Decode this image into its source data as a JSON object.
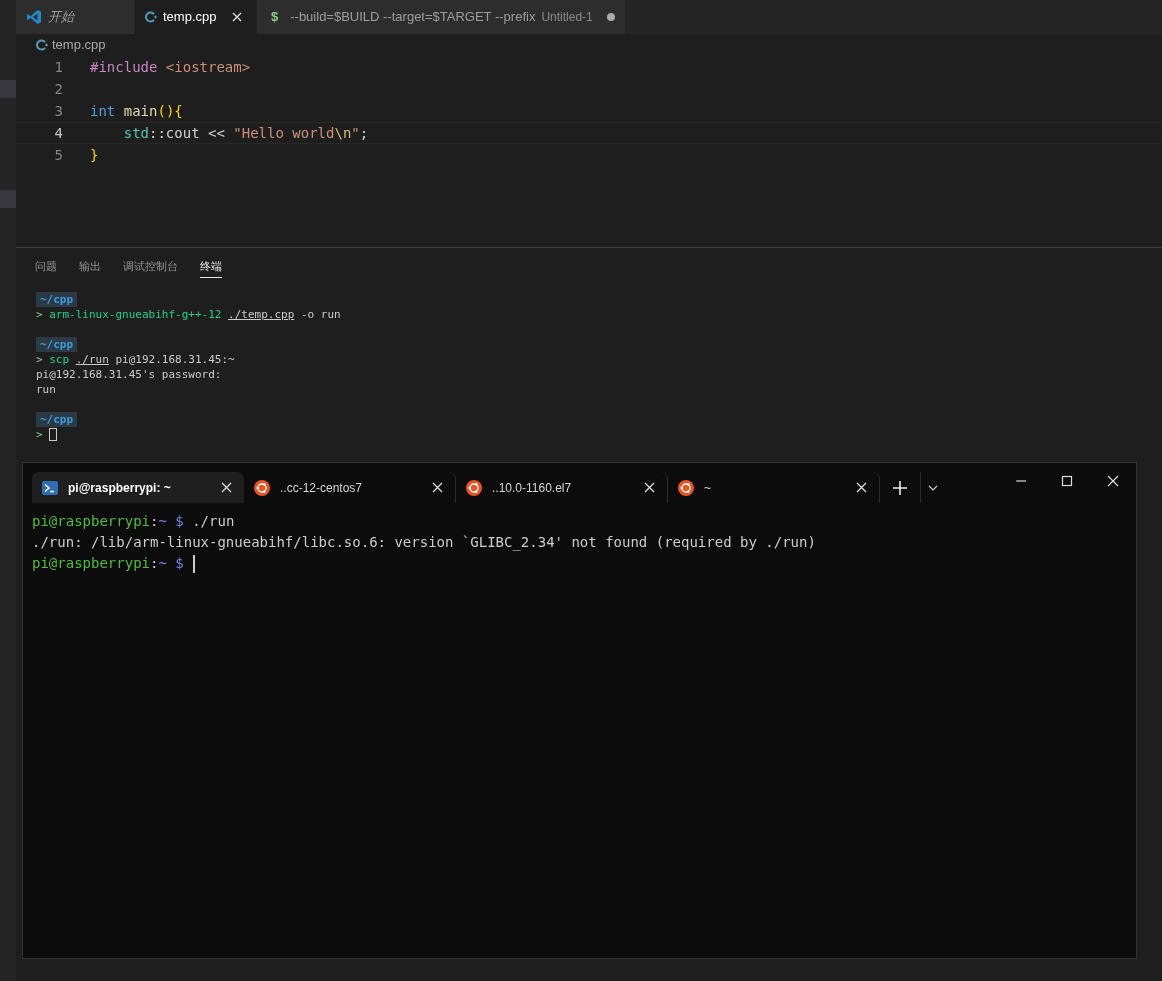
{
  "editor_tabs": [
    {
      "kind": "welcome",
      "label": "开始",
      "selected": false
    },
    {
      "kind": "file",
      "label": "temp.cpp",
      "selected": true
    },
    {
      "kind": "untitled",
      "icon_text": "$",
      "label": "--build=$BUILD --target=$TARGET --prefix",
      "description": "Untitled-1",
      "selected": false
    }
  ],
  "breadcrumb": "temp.cpp",
  "code_lines": [
    {
      "number": "1",
      "current": false,
      "tokens": [
        {
          "kind": "preproc",
          "text": "#include"
        },
        {
          "kind": "string",
          "text": " <iostream>"
        }
      ]
    },
    {
      "number": "2",
      "current": false
    },
    {
      "number": "3",
      "current": false,
      "tokens": [
        {
          "kind": "type",
          "text": "int"
        },
        {
          "kind": "func",
          "text": " main"
        },
        {
          "kind": "bracket",
          "text": "(){"
        }
      ]
    },
    {
      "number": "4",
      "current": true,
      "tokens": [
        {
          "kind": "namespace",
          "text": "    std"
        },
        {
          "kind": "plain",
          "text": "::cout << "
        },
        {
          "kind": "string",
          "text": "\"Hello world"
        },
        {
          "kind": "escape",
          "text": "\\n"
        },
        {
          "kind": "string",
          "text": "\""
        },
        {
          "kind": "plain",
          "text": ";"
        }
      ]
    },
    {
      "number": "5",
      "current": false,
      "tokens": [
        {
          "kind": "bracket",
          "text": "}"
        }
      ]
    }
  ],
  "panel_tabs": [
    {
      "label": "问题",
      "selected": false
    },
    {
      "label": "输出",
      "selected": false
    },
    {
      "label": "调试控制台",
      "selected": false
    },
    {
      "label": "终端",
      "selected": true
    }
  ],
  "panel_terminal": [
    {
      "kind": "path",
      "text": "~/cpp"
    },
    {
      "kind": "command",
      "segments": [
        {
          "kind": "arrow",
          "text": "> "
        },
        {
          "kind": "cmd",
          "text": "arm-linux-gnueabihf-g++-12 "
        },
        {
          "kind": "link",
          "text": "./temp.cpp"
        },
        {
          "kind": "plain",
          "text": " -o run"
        }
      ]
    },
    {
      "kind": "blank"
    },
    {
      "kind": "path",
      "text": "~/cpp"
    },
    {
      "kind": "command",
      "segments": [
        {
          "kind": "arrow",
          "text": "> "
        },
        {
          "kind": "cmd",
          "text": "scp "
        },
        {
          "kind": "link",
          "text": "./run"
        },
        {
          "kind": "plain",
          "text": " pi@192.168.31.45:~"
        }
      ]
    },
    {
      "kind": "output",
      "text": "pi@192.168.31.45's password:"
    },
    {
      "kind": "output",
      "text": "run"
    },
    {
      "kind": "blank"
    },
    {
      "kind": "path",
      "text": "~/cpp"
    },
    {
      "kind": "command",
      "segments": [
        {
          "kind": "arrow",
          "text": "> "
        },
        {
          "kind": "cursor"
        }
      ]
    }
  ],
  "terminal_window": {
    "tabs": [
      {
        "kind": "powershell",
        "label": "pi@raspberrypi: ~",
        "selected": true
      },
      {
        "kind": "ubuntu",
        "label": "..cc-12-centos7",
        "selected": false
      },
      {
        "kind": "ubuntu",
        "label": "..10.0-1160.el7",
        "selected": false
      },
      {
        "kind": "ubuntu",
        "label": "~",
        "selected": false
      }
    ],
    "lines": [
      {
        "segments": [
          {
            "kind": "user",
            "text": "pi@raspberrypi"
          },
          {
            "kind": "plain",
            "text": ":"
          },
          {
            "kind": "path",
            "text": "~ $"
          },
          {
            "kind": "plain",
            "text": " ./run"
          }
        ]
      },
      {
        "segments": [
          {
            "kind": "plain",
            "text": "./run: /lib/arm-linux-gnueabihf/libc.so.6: version `GLIBC_2.34' not found (required by ./run)"
          }
        ]
      },
      {
        "segments": [
          {
            "kind": "user",
            "text": "pi@raspberrypi"
          },
          {
            "kind": "plain",
            "text": ":"
          },
          {
            "kind": "path",
            "text": "~ $"
          },
          {
            "kind": "cursor"
          }
        ]
      }
    ]
  }
}
